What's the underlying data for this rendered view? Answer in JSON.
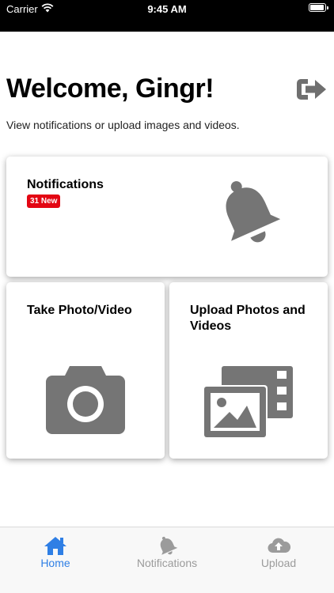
{
  "status_bar": {
    "carrier": "Carrier",
    "time": "9:45 AM"
  },
  "header": {
    "title": "Welcome, Gingr!",
    "subtitle": "View notifications or upload images and videos."
  },
  "cards": {
    "notifications": {
      "title": "Notifications",
      "badge": "31 New"
    },
    "take_photo": {
      "title": "Take Photo/Video"
    },
    "upload": {
      "title": "Upload Photos and Videos"
    }
  },
  "icons": {
    "logout": "logout-icon",
    "bell": "bell-icon",
    "camera": "camera-icon",
    "images": "images-icon"
  },
  "tab_bar": {
    "tabs": [
      {
        "label": "Home",
        "icon": "home-icon",
        "active": true
      },
      {
        "label": "Notifications",
        "icon": "bell-icon",
        "active": false
      },
      {
        "label": "Upload",
        "icon": "cloud-upload-icon",
        "active": false
      }
    ]
  },
  "colors": {
    "accent": "#2f7fe5",
    "badge": "#e30613",
    "icon_gray": "#757575",
    "inactive_tab": "#9b9b9b"
  }
}
